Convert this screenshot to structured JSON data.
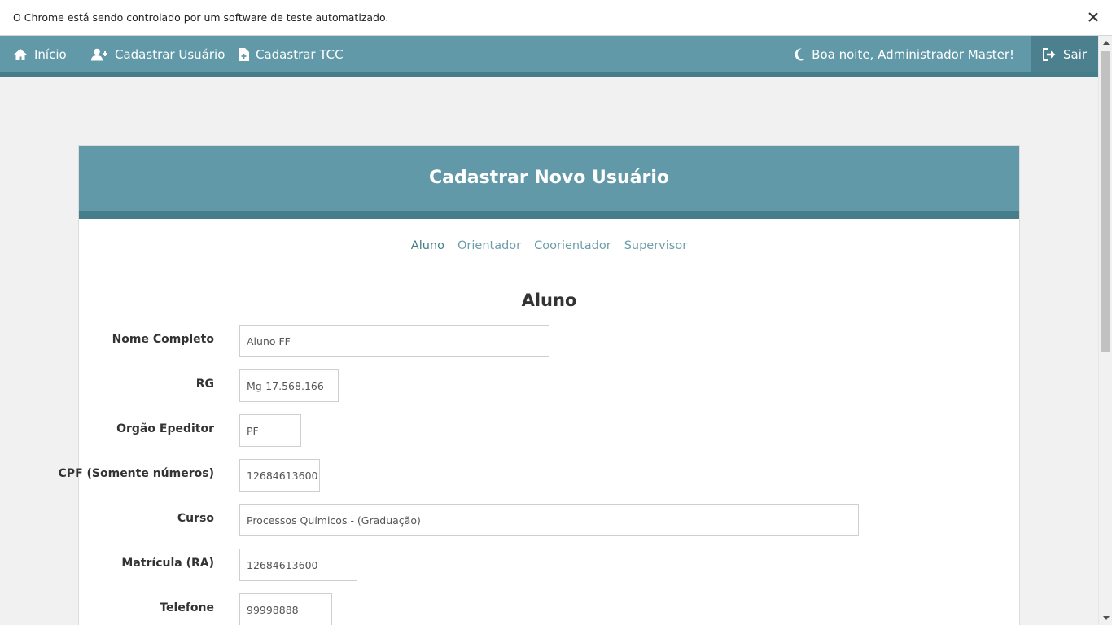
{
  "infobar": {
    "message": "O Chrome está sendo controlado por um software de teste automatizado."
  },
  "navbar": {
    "home": "Início",
    "register_user": "Cadastrar Usuário",
    "register_tcc": "Cadastrar TCC",
    "greeting": "Boa noite, Administrador Master!",
    "logout": "Sair"
  },
  "card": {
    "title": "Cadastrar Novo Usuário",
    "tabs": [
      "Aluno",
      "Orientador",
      "Coorientador",
      "Supervisor"
    ],
    "active_tab": "Aluno",
    "section_title": "Aluno"
  },
  "form": {
    "nome": {
      "label": "Nome Completo",
      "value": "Aluno FF"
    },
    "rg": {
      "label": "RG",
      "value": "Mg-17.568.166"
    },
    "orgao": {
      "label": "Orgão Epeditor",
      "value": "PF"
    },
    "cpf": {
      "label": "CPF (Somente números)",
      "value": "12684613600"
    },
    "curso": {
      "label": "Curso",
      "value": "Processos Químicos - (Graduação)"
    },
    "matricula": {
      "label": "Matrícula (RA)",
      "value": "12684613600"
    },
    "telefone": {
      "label": "Telefone",
      "value": "99998888"
    }
  },
  "colors": {
    "primary": "#6199a8",
    "primary_dark": "#467d8b",
    "background": "#f1f1f1"
  }
}
